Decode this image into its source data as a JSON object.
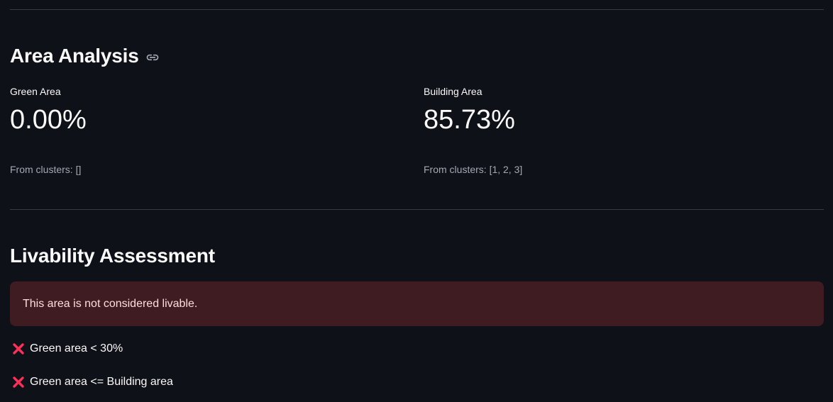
{
  "area_analysis": {
    "title": "Area Analysis",
    "link_icon": "link-icon",
    "green": {
      "label": "Green Area",
      "value": "0.00%",
      "caption": "From clusters: []"
    },
    "building": {
      "label": "Building Area",
      "value": "85.73%",
      "caption": "From clusters: [1, 2, 3]"
    }
  },
  "livability": {
    "title": "Livability Assessment",
    "alert_text": "This area is not considered livable.",
    "checks": [
      {
        "icon": "cross-mark-icon",
        "text": "Green area < 30%"
      },
      {
        "icon": "cross-mark-icon",
        "text": "Green area <= Building area"
      }
    ]
  },
  "colors": {
    "background": "#0e1117",
    "alert_background": "#3e2327",
    "cross_mark": "#ff2f5a"
  }
}
